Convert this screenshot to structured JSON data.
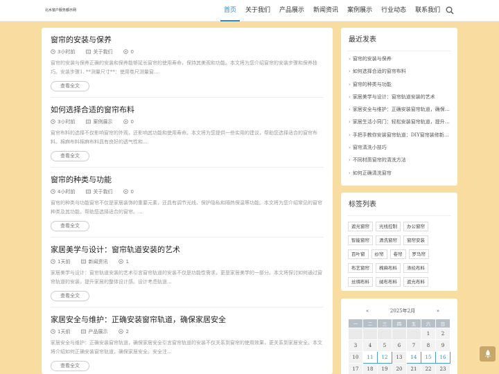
{
  "site": {
    "logo": "北水窗户服务都示网"
  },
  "nav": [
    "首页",
    "关于我们",
    "产品展示",
    "新闻资讯",
    "案例展示",
    "行业动态",
    "联系我们"
  ],
  "posts": [
    {
      "title": "窗帘的安装与保养",
      "time": "3小时前",
      "category": "关于我们",
      "comments": "0",
      "excerpt": "窗帘的安装与保养正确的安装和保养能够延长窗帘的使用寿命，保持其美观和功能。本文将为您介绍窗帘的安装步骤和保养技巧。安装步骤1. **测量尺寸**：使用卷尺测量窗...",
      "more": "查看全文"
    },
    {
      "title": "如何选择合适的窗帘布料",
      "time": "3小时前",
      "category": "案例展示",
      "comments": "0",
      "excerpt": "窗帘布料的选择不仅影响窗帘的外观，还影响其功能和使用寿命。本文将为您提供一些实用的建议，帮助您选择适合的窗帘布料。棉麻布料棉麻布料具有良好的透气性和...",
      "more": "查看全文"
    },
    {
      "title": "窗帘的种类与功能",
      "time": "4小时前",
      "category": "关于我们",
      "comments": "0",
      "excerpt": "窗帘的种类与功能窗帘不仅是家居装饰的重要元素，还具有调节光线、保护隐私和隔热保温等功能。本文将为您介绍常见的窗帘种类及其功能，帮助您选择适合的窗帘。...",
      "more": "查看全文"
    },
    {
      "title": "家居美学与设计：窗帘轨道安装的艺术",
      "time": "1天前",
      "category": "新闻资讯",
      "comments": "1",
      "excerpt": "家居美学与设计：窗帘轨道安装的艺术引言窗帘轨道的安装不仅是功能性需求，更是家居美学的一部分。本文将探讨如何通过窗帘轨道的安装，提升家居的整体设计感。设计考虑轨道...",
      "more": "查看全文"
    },
    {
      "title": "家居安全与维护：正确安装窗帘轨道，确保家居安全",
      "time": "1天前",
      "category": "产品展示",
      "comments": "2",
      "excerpt": "家居安全与维护：正确安装窗帘轨道，确保家居安全引言窗帘轨道的安装不仅关系到窗帘的使用效果，更关系到家居安全。本文将介绍如何正确安装窗帘轨道，确保家居安全。安全注...",
      "more": "查看全文"
    }
  ],
  "recent": {
    "title": "最近发表",
    "items": [
      "窗帘的安装与保养",
      "如何选择合适的窗帘布料",
      "窗帘的种类与功能",
      "家居美学与设计：窗帘轨道安装的艺术",
      "家居安全与维护：正确安装窗帘轨道，确保家居安全",
      "家居生活小窍门：轻松安装窗帘轨道，提升家居品质",
      "手把手教你安装窗帘轨道：DIY窗帘装修新手指南",
      "窗帘清洗小技巧",
      "不同材质窗帘的清洗方法",
      "如何正确清洗窗帘"
    ]
  },
  "tags": {
    "title": "标签列表",
    "items": [
      "遮光窗帘",
      "光线控制",
      "办公窗帘",
      "智能窗帘",
      "清洗窗帘",
      "窗帘安装",
      "百叶窗",
      "纱帘",
      "卷帘",
      "罗马帘",
      "布艺窗帘",
      "棉麻布料",
      "涤纶布料",
      "丝绸布料",
      "绒布布料",
      "遮光布料"
    ]
  },
  "calendar": {
    "prev": "«",
    "month": "2025年2月",
    "next": "»",
    "weekdays": [
      "一",
      "二",
      "三",
      "四",
      "五",
      "六",
      "日"
    ],
    "rows": [
      [
        "",
        "",
        "",
        "",
        "",
        "1",
        "2"
      ],
      [
        "3",
        "4",
        "5",
        "6",
        "7",
        "8",
        "9"
      ],
      [
        "10",
        "11",
        "12",
        "13",
        "14",
        "15",
        "16"
      ],
      [
        "17",
        "18",
        "19",
        "20",
        "21",
        "22",
        "23"
      ]
    ],
    "linked_days": [
      "11",
      "12",
      "14",
      "15",
      "16"
    ]
  },
  "icons": {
    "search": "search-icon",
    "clock": "clock-icon",
    "folder": "folder-icon",
    "comment": "comment-icon",
    "back_to_top": "rocket-icon"
  },
  "colors": {
    "accent": "#2f89c5",
    "background": "#f8dca0",
    "to_top": "#c8a86a"
  }
}
